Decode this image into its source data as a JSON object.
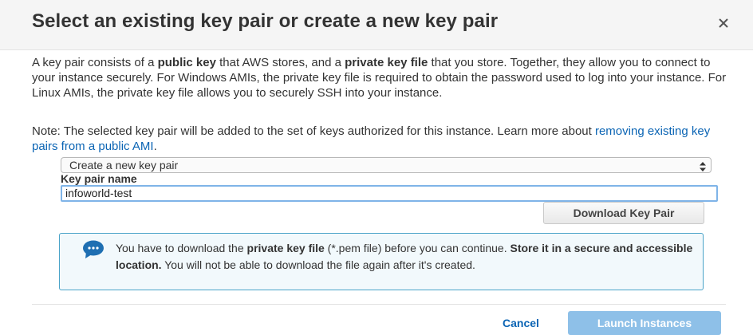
{
  "dialog": {
    "title": "Select an existing key pair or create a new key pair",
    "close_icon": "close-icon"
  },
  "intro": {
    "t1": "A key pair consists of a ",
    "b1": "public key",
    "t2": " that AWS stores, and a ",
    "b2": "private key file",
    "t3": " that you store. Together, they allow you to connect to your instance securely. For Windows AMIs, the private key file is required to obtain the password used to log into your instance. For Linux AMIs, the private key file allows you to securely SSH into your instance."
  },
  "note": {
    "text": "Note: The selected key pair will be added to the set of keys authorized for this instance. Learn more about ",
    "link": "removing existing key pairs from a public AMI",
    "suffix": "."
  },
  "key_pair_select": {
    "selected": "Create a new key pair",
    "arrows_icon": "select-arrows-icon"
  },
  "key_pair_name": {
    "label": "Key pair name",
    "value": "infoworld-test"
  },
  "download_button": {
    "label": "Download Key Pair"
  },
  "info": {
    "icon": "chat-bubble-icon",
    "t1": "You have to download the ",
    "b1": "private key file",
    "t2": " (*.pem file) before you can continue. ",
    "b2": "Store it in a secure and accessible location.",
    "t3": " You will not be able to download the file again after it's created.",
    "border_color": "#4aa3c8",
    "background_color": "#f2f9fc"
  },
  "footer": {
    "cancel": "Cancel",
    "launch": "Launch Instances",
    "launch_color": "#8ec0e8",
    "link_color": "#0a64b4"
  }
}
